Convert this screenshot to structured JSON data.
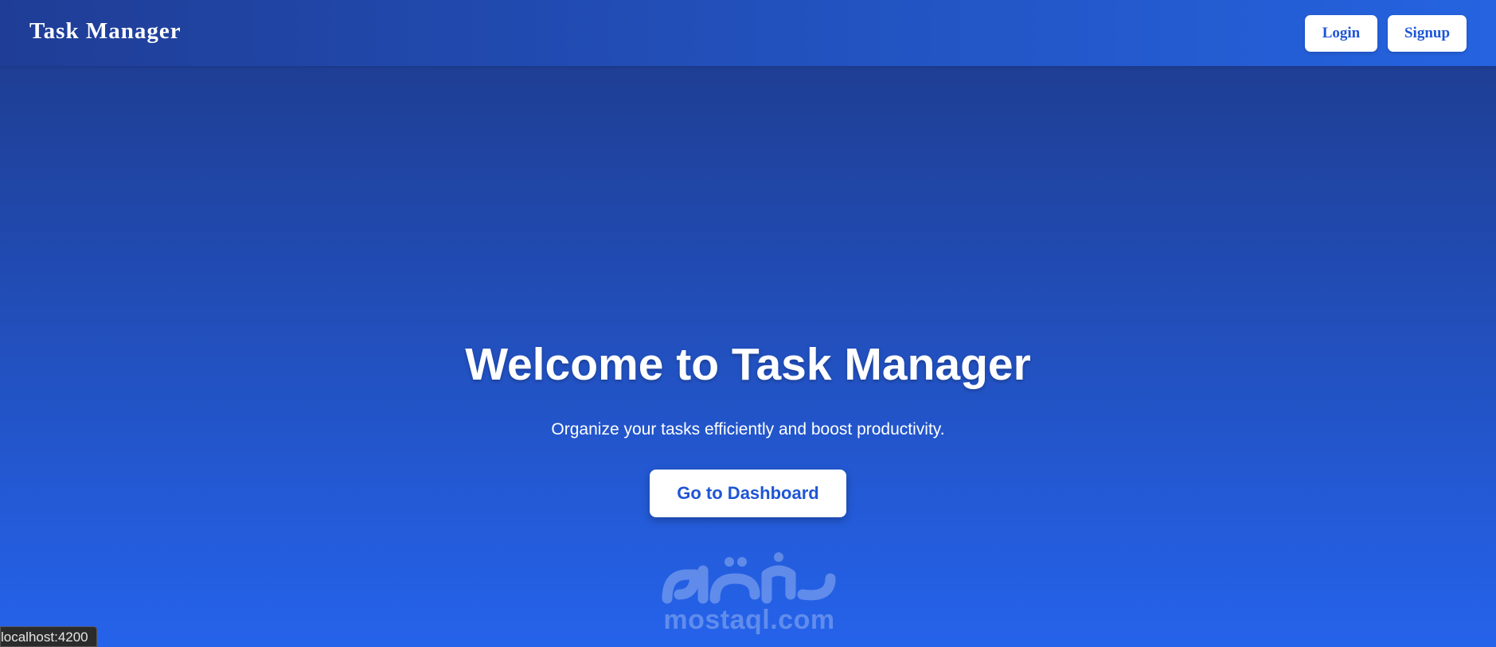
{
  "header": {
    "brand": "Task Manager",
    "login_label": "Login",
    "signup_label": "Signup"
  },
  "hero": {
    "title": "Welcome to Task Manager",
    "subtitle": "Organize your tasks efficiently and boost productivity.",
    "cta_label": "Go to Dashboard"
  },
  "watermark": {
    "text": "mostaql.com",
    "logo_icon": "mostaql-logo-icon"
  },
  "status_bar": {
    "url": "localhost:4200"
  },
  "colors": {
    "accent": "#2563eb",
    "dark_accent": "#1e3a8a",
    "button_text": "#1e55d6"
  }
}
